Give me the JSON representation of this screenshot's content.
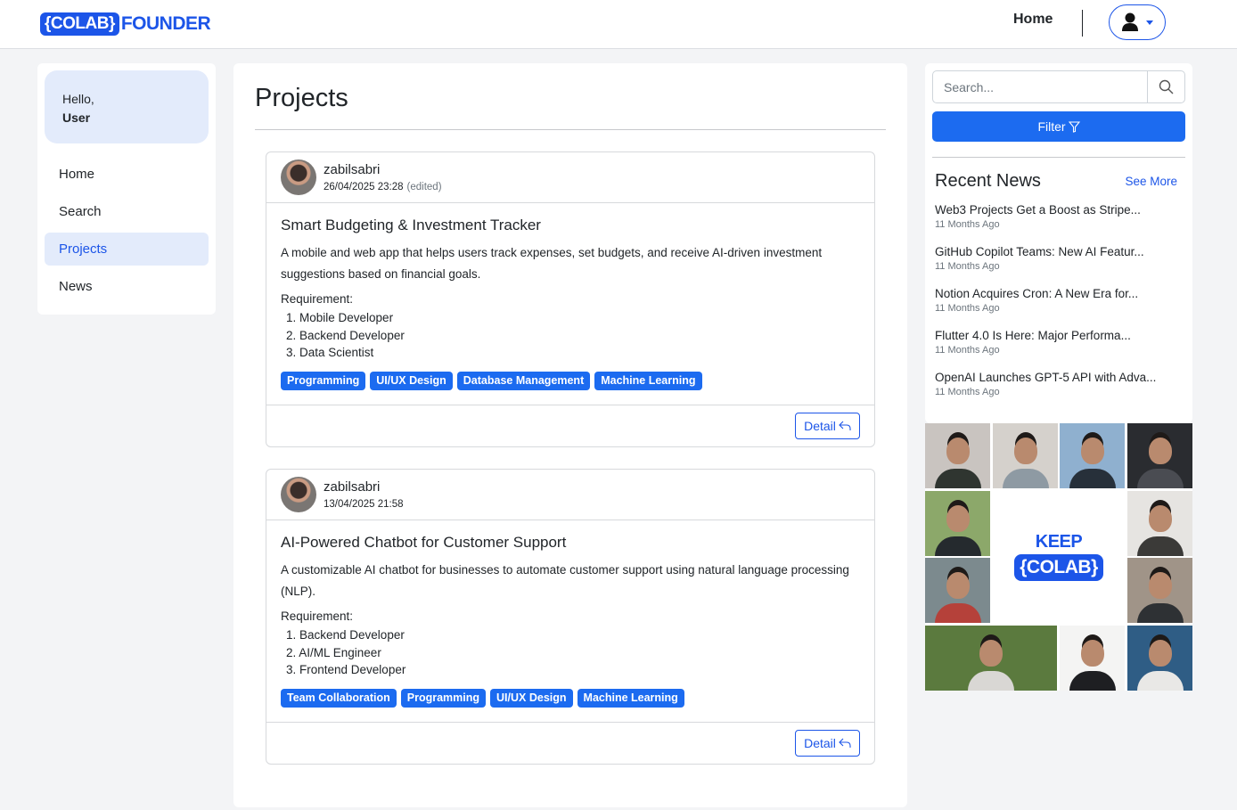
{
  "brand": {
    "box_text": "{COLAB}",
    "suffix": "FOUNDER"
  },
  "topnav": {
    "home_label": "Home"
  },
  "sidebar": {
    "greeting": "Hello,",
    "user": "User",
    "items": [
      {
        "label": "Home",
        "active": false
      },
      {
        "label": "Search",
        "active": false
      },
      {
        "label": "Projects",
        "active": true
      },
      {
        "label": "News",
        "active": false
      }
    ]
  },
  "main": {
    "title": "Projects",
    "projects": [
      {
        "author": "zabilsabri",
        "date": "26/04/2025 23:28",
        "edited": "(edited)",
        "title": "Smart Budgeting & Investment Tracker",
        "description": "A mobile and web app that helps users track expenses, set budgets, and receive AI-driven investment suggestions based on financial goals.",
        "requirement_label": "Requirement:",
        "requirements": [
          "1. Mobile Developer",
          "2. Backend Developer",
          "3. Data Scientist"
        ],
        "tags": [
          "Programming",
          "UI/UX Design",
          "Database Management",
          "Machine Learning"
        ],
        "detail_label": "Detail"
      },
      {
        "author": "zabilsabri",
        "date": "13/04/2025 21:58",
        "edited": "",
        "title": "AI-Powered Chatbot for Customer Support",
        "description": "A customizable AI chatbot for businesses to automate customer support using natural language processing (NLP).",
        "requirement_label": "Requirement:",
        "requirements": [
          "1. Backend Developer",
          "2. AI/ML Engineer",
          "3. Frontend Developer"
        ],
        "tags": [
          "Team Collaboration",
          "Programming",
          "UI/UX Design",
          "Machine Learning"
        ],
        "detail_label": "Detail"
      }
    ]
  },
  "rightbar": {
    "search_placeholder": "Search...",
    "filter_label": "Filter",
    "news_title": "Recent News",
    "see_more": "See More",
    "news": [
      {
        "headline": "Web3 Projects Get a Boost as Stripe...",
        "ago": "11 Months Ago"
      },
      {
        "headline": "GitHub Copilot Teams: New AI Featur...",
        "ago": "11 Months Ago"
      },
      {
        "headline": "Notion Acquires Cron: A New Era for...",
        "ago": "11 Months Ago"
      },
      {
        "headline": "Flutter 4.0 Is Here: Major Performa...",
        "ago": "11 Months Ago"
      },
      {
        "headline": "OpenAI Launches GPT-5 API with Adva...",
        "ago": "11 Months Ago"
      }
    ],
    "collage": {
      "keep_word": "KEEP",
      "keep_box": "{COLAB}"
    }
  },
  "colors": {
    "accent": "#1c55e8",
    "tag": "#1c6bf0",
    "active_bg": "#e3ebfb",
    "page_bg": "#f3f4f6"
  }
}
